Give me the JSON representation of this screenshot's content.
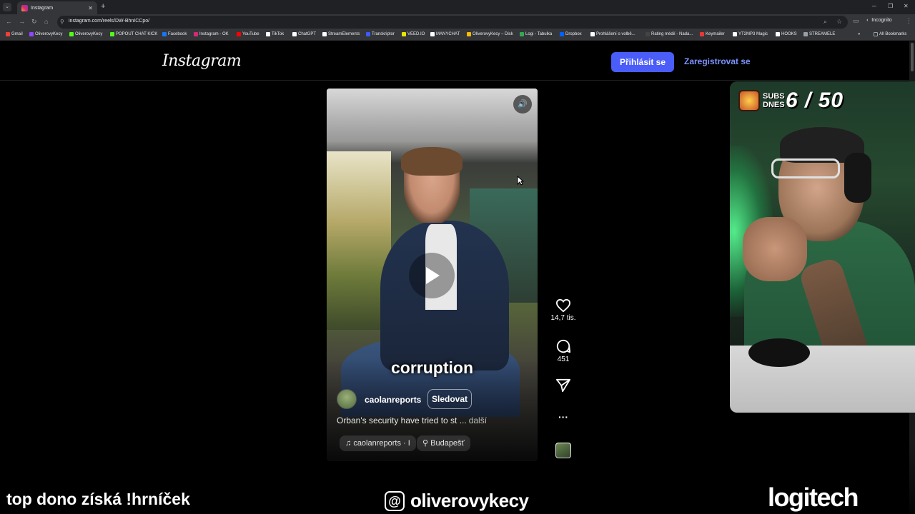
{
  "browser": {
    "tab_title": "Instagram",
    "tab_close": "✕",
    "new_tab": "+",
    "url": "instagram.com/reels/DW-BhnICCpo/",
    "incognito_label": "Incognito",
    "all_bookmarks": "All Bookmarks",
    "bookmarks": [
      {
        "label": "Gmail",
        "color": "#ea4335"
      },
      {
        "label": "OliverovyKecy",
        "color": "#9146ff"
      },
      {
        "label": "OliverovyKecy",
        "color": "#53fc18"
      },
      {
        "label": "POPOUT CHAT KICK",
        "color": "#53fc18"
      },
      {
        "label": "Facebook",
        "color": "#1877f2"
      },
      {
        "label": "Instagram - OK",
        "color": "#d62976"
      },
      {
        "label": "YouTube",
        "color": "#ff0000"
      },
      {
        "label": "TikTok",
        "color": "#ffffff"
      },
      {
        "label": "ChatGPT",
        "color": "#ffffff"
      },
      {
        "label": "StreamElements",
        "color": "#ffffff"
      },
      {
        "label": "Transkriptor",
        "color": "#3d5afe"
      },
      {
        "label": "VEED.IO",
        "color": "#e6e600"
      },
      {
        "label": "MANYCHAT",
        "color": "#ffffff"
      },
      {
        "label": "OliverovyKecy – Disk",
        "color": "#fbbc04"
      },
      {
        "label": "Logi - Tabulka",
        "color": "#34a853"
      },
      {
        "label": "Dropbox",
        "color": "#0061ff"
      },
      {
        "label": "Prohlášení o volbě...",
        "color": "#ffffff"
      },
      {
        "label": "Rating médií - Nada...",
        "color": "#444444"
      },
      {
        "label": "Keymailer",
        "color": "#e53935"
      },
      {
        "label": "YT2MP3 Magic",
        "color": "#ffffff"
      },
      {
        "label": "HOOKS",
        "color": "#ffffff"
      },
      {
        "label": "STREAMELE",
        "color": "#9aa0a6"
      }
    ]
  },
  "instagram": {
    "logo": "Instagram",
    "login_label": "Přihlásit se",
    "signup_label": "Zaregistrovat se",
    "reel": {
      "caption_word": "corruption",
      "author": "caolanreports",
      "follow_label": "Sledovat",
      "description": "Orban's security have tried to st ...",
      "more_label": "další",
      "audio": "caolanreports · I",
      "location": "Budapešť",
      "likes": "14,7 tis.",
      "comments": "451",
      "more_icon": "···"
    }
  },
  "overlay": {
    "subs_label_1": "SUBS",
    "subs_label_2": "DNES",
    "subs_count": "6 / 50",
    "donation_text": "top dono získá !hrníček",
    "threads_handle": "oliverovykecy",
    "sponsor": "logitech"
  }
}
